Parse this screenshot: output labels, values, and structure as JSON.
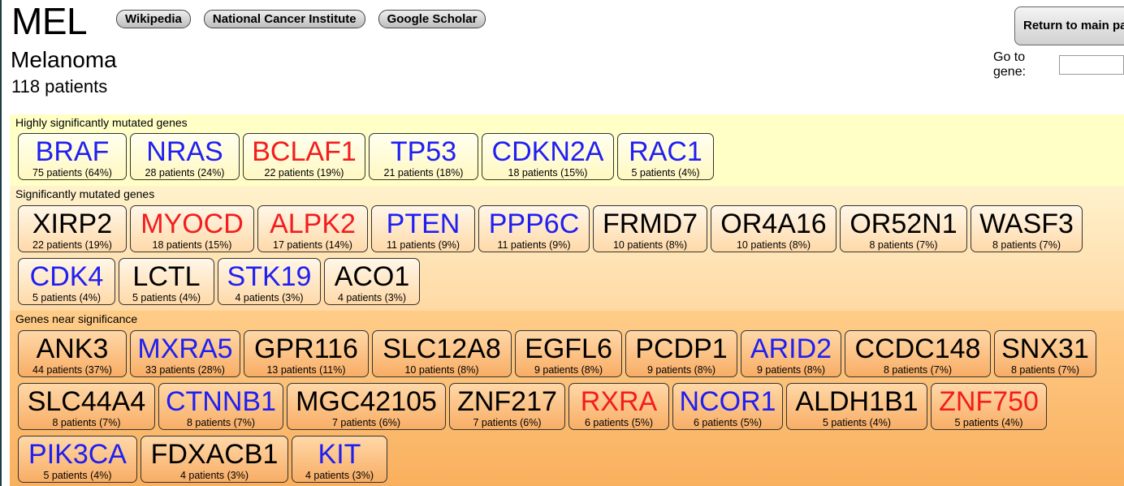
{
  "header": {
    "code": "MEL",
    "name": "Melanoma",
    "patients": "118 patients",
    "links": [
      "Wikipedia",
      "National Cancer Institute",
      "Google Scholar"
    ],
    "return_label": "Return to main page",
    "goto_label": "Go to gene:",
    "goto_value": ""
  },
  "colors": {
    "known_driver": "#1f1ff2",
    "novel": "#f21d1d",
    "other": "#000000"
  },
  "sections": [
    {
      "title": "Highly significantly mutated genes",
      "genes": [
        {
          "name": "BRAF",
          "count": "75 patients (64%)",
          "color": "blue"
        },
        {
          "name": "NRAS",
          "count": "28 patients (24%)",
          "color": "blue"
        },
        {
          "name": "BCLAF1",
          "count": "22 patients (19%)",
          "color": "red"
        },
        {
          "name": "TP53",
          "count": "21 patients (18%)",
          "color": "blue"
        },
        {
          "name": "CDKN2A",
          "count": "18 patients (15%)",
          "color": "blue"
        },
        {
          "name": "RAC1",
          "count": "5 patients (4%)",
          "color": "blue"
        }
      ]
    },
    {
      "title": "Significantly mutated genes",
      "genes": [
        {
          "name": "XIRP2",
          "count": "22 patients (19%)",
          "color": "black"
        },
        {
          "name": "MYOCD",
          "count": "18 patients (15%)",
          "color": "red"
        },
        {
          "name": "ALPK2",
          "count": "17 patients (14%)",
          "color": "red"
        },
        {
          "name": "PTEN",
          "count": "11 patients (9%)",
          "color": "blue"
        },
        {
          "name": "PPP6C",
          "count": "11 patients (9%)",
          "color": "blue"
        },
        {
          "name": "FRMD7",
          "count": "10 patients (8%)",
          "color": "black"
        },
        {
          "name": "OR4A16",
          "count": "10 patients (8%)",
          "color": "black"
        },
        {
          "name": "OR52N1",
          "count": "8 patients (7%)",
          "color": "black"
        },
        {
          "name": "WASF3",
          "count": "8 patients (7%)",
          "color": "black"
        },
        {
          "name": "CDK4",
          "count": "5 patients (4%)",
          "color": "blue"
        },
        {
          "name": "LCTL",
          "count": "5 patients (4%)",
          "color": "black"
        },
        {
          "name": "STK19",
          "count": "4 patients (3%)",
          "color": "blue"
        },
        {
          "name": "ACO1",
          "count": "4 patients (3%)",
          "color": "black"
        }
      ]
    },
    {
      "title": "Genes near significance",
      "genes": [
        {
          "name": "ANK3",
          "count": "44 patients (37%)",
          "color": "black"
        },
        {
          "name": "MXRA5",
          "count": "33 patients (28%)",
          "color": "blue"
        },
        {
          "name": "GPR116",
          "count": "13 patients (11%)",
          "color": "black"
        },
        {
          "name": "SLC12A8",
          "count": "10 patients (8%)",
          "color": "black"
        },
        {
          "name": "EGFL6",
          "count": "9 patients (8%)",
          "color": "black"
        },
        {
          "name": "PCDP1",
          "count": "9 patients (8%)",
          "color": "black"
        },
        {
          "name": "ARID2",
          "count": "9 patients (8%)",
          "color": "blue"
        },
        {
          "name": "CCDC148",
          "count": "8 patients (7%)",
          "color": "black"
        },
        {
          "name": "SNX31",
          "count": "8 patients (7%)",
          "color": "black"
        },
        {
          "name": "SLC44A4",
          "count": "8 patients (7%)",
          "color": "black"
        },
        {
          "name": "CTNNB1",
          "count": "8 patients (7%)",
          "color": "blue"
        },
        {
          "name": "MGC42105",
          "count": "7 patients (6%)",
          "color": "black"
        },
        {
          "name": "ZNF217",
          "count": "7 patients (6%)",
          "color": "black"
        },
        {
          "name": "RXRA",
          "count": "6 patients (5%)",
          "color": "red"
        },
        {
          "name": "NCOR1",
          "count": "6 patients (5%)",
          "color": "blue"
        },
        {
          "name": "ALDH1B1",
          "count": "5 patients (4%)",
          "color": "black"
        },
        {
          "name": "ZNF750",
          "count": "5 patients (4%)",
          "color": "red"
        },
        {
          "name": "PIK3CA",
          "count": "5 patients (4%)",
          "color": "blue"
        },
        {
          "name": "FDXACB1",
          "count": "4 patients (3%)",
          "color": "black"
        },
        {
          "name": "KIT",
          "count": "4 patients (3%)",
          "color": "blue"
        }
      ]
    }
  ]
}
